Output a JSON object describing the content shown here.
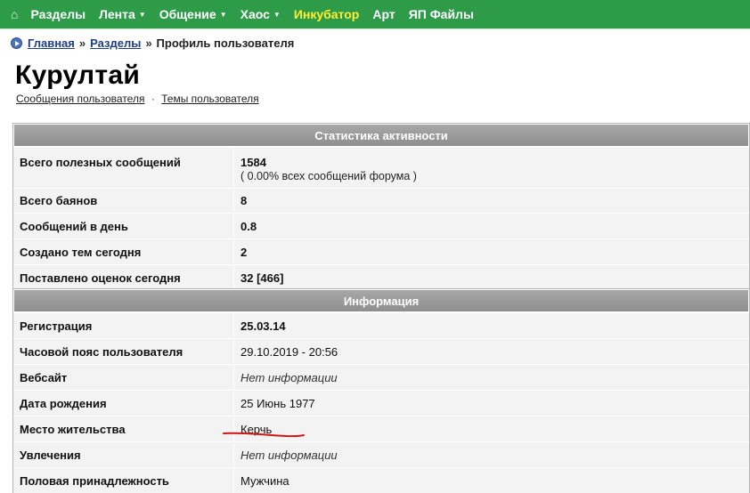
{
  "nav": {
    "items": [
      {
        "label": "Разделы",
        "dropdown": false,
        "highlight": false
      },
      {
        "label": "Лента",
        "dropdown": true,
        "highlight": false
      },
      {
        "label": "Общение",
        "dropdown": true,
        "highlight": false
      },
      {
        "label": "Хаос",
        "dropdown": true,
        "highlight": false
      },
      {
        "label": "Инкубатор",
        "dropdown": false,
        "highlight": true
      },
      {
        "label": "Арт",
        "dropdown": false,
        "highlight": false
      },
      {
        "label": "ЯП Файлы",
        "dropdown": false,
        "highlight": false
      }
    ],
    "caret": "▼",
    "home_icon": "⌂"
  },
  "breadcrumb": {
    "home": "Главная",
    "sections": "Разделы",
    "separator": "»",
    "current": "Профиль пользователя"
  },
  "profile": {
    "username": "Курултай",
    "links": {
      "messages": "Сообщения пользователя",
      "dot": "·",
      "topics": "Темы пользователя"
    }
  },
  "stats": {
    "header": "Статистика активности",
    "useful_posts": {
      "label": "Всего полезных сообщений",
      "value": "1584",
      "sub": "( 0.00% всех сообщений форума )"
    },
    "bayans": {
      "label": "Всего баянов",
      "value": "8"
    },
    "posts_per_day": {
      "label": "Сообщений в день",
      "value": "0.8"
    },
    "topics_today": {
      "label": "Создано тем сегодня",
      "value": "2"
    },
    "ratings_today": {
      "label": "Поставлено оценок сегодня",
      "value": "32 [466]"
    }
  },
  "info": {
    "header": "Информация",
    "registration": {
      "label": "Регистрация",
      "value": "25.03.14"
    },
    "timezone": {
      "label": "Часовой пояс пользователя",
      "value": "29.10.2019 - 20:56"
    },
    "website": {
      "label": "Вебсайт",
      "value": "Нет информации"
    },
    "birthday": {
      "label": "Дата рождения",
      "value": "25 Июнь 1977"
    },
    "location": {
      "label": "Место жительства",
      "value": "Керчь"
    },
    "hobbies": {
      "label": "Увлечения",
      "value": "Нет информации"
    },
    "gender": {
      "label": "Половая принадлежность",
      "value": "Мужчина"
    }
  },
  "colors": {
    "nav_bg": "#2e9b48",
    "highlight": "#ffef35",
    "panel_header": "#999999",
    "annotation": "#d01818"
  }
}
